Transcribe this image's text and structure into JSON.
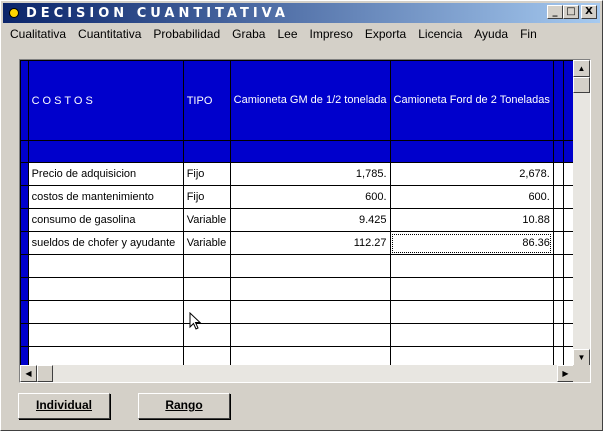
{
  "window": {
    "title": "DECISION   CUANTITATIVA",
    "controls": {
      "minimize": "_",
      "maximize": "□",
      "close": "X"
    }
  },
  "menu": [
    {
      "label": "Cualitativa"
    },
    {
      "label": "Cuantitativa"
    },
    {
      "label": "Probabilidad"
    },
    {
      "label": "Graba"
    },
    {
      "label": "Lee"
    },
    {
      "label": "Impreso"
    },
    {
      "label": "Exporta"
    },
    {
      "label": "Licencia"
    },
    {
      "label": "Ayuda"
    },
    {
      "label": "Fin"
    }
  ],
  "grid": {
    "headers": {
      "costos": "COSTOS",
      "tipo": "TIPO",
      "col1": "Camioneta GM de 1/2 tonelada",
      "col2": "Camioneta Ford de 2 Toneladas",
      "col3": "",
      "col4": ""
    },
    "rows": [
      {
        "costo": "Precio de adquisicion",
        "tipo": "Fijo",
        "v1": "1,785.",
        "v2": "2,678."
      },
      {
        "costo": "costos de mantenimiento",
        "tipo": "Fijo",
        "v1": "600.",
        "v2": "600."
      },
      {
        "costo": "consumo de gasolina",
        "tipo": "Variable",
        "v1": "9.425",
        "v2": "10.88"
      },
      {
        "costo": "sueldos de chofer y ayudante",
        "tipo": "Variable",
        "v1": "112.27",
        "v2": "86.36"
      },
      {
        "costo": "",
        "tipo": "",
        "v1": "",
        "v2": ""
      },
      {
        "costo": "",
        "tipo": "",
        "v1": "",
        "v2": ""
      },
      {
        "costo": "",
        "tipo": "",
        "v1": "",
        "v2": ""
      },
      {
        "costo": "",
        "tipo": "",
        "v1": "",
        "v2": ""
      },
      {
        "costo": "",
        "tipo": "",
        "v1": "",
        "v2": ""
      }
    ],
    "scroll_arrows": {
      "up": "▲",
      "down": "▼",
      "left": "◀",
      "right": "▶"
    }
  },
  "buttons": {
    "individual": "Individual",
    "rango": "Rango"
  },
  "colors": {
    "header_blue": "#0000cc",
    "titlebar_start": "#0a246a",
    "titlebar_end": "#a6caf0"
  }
}
